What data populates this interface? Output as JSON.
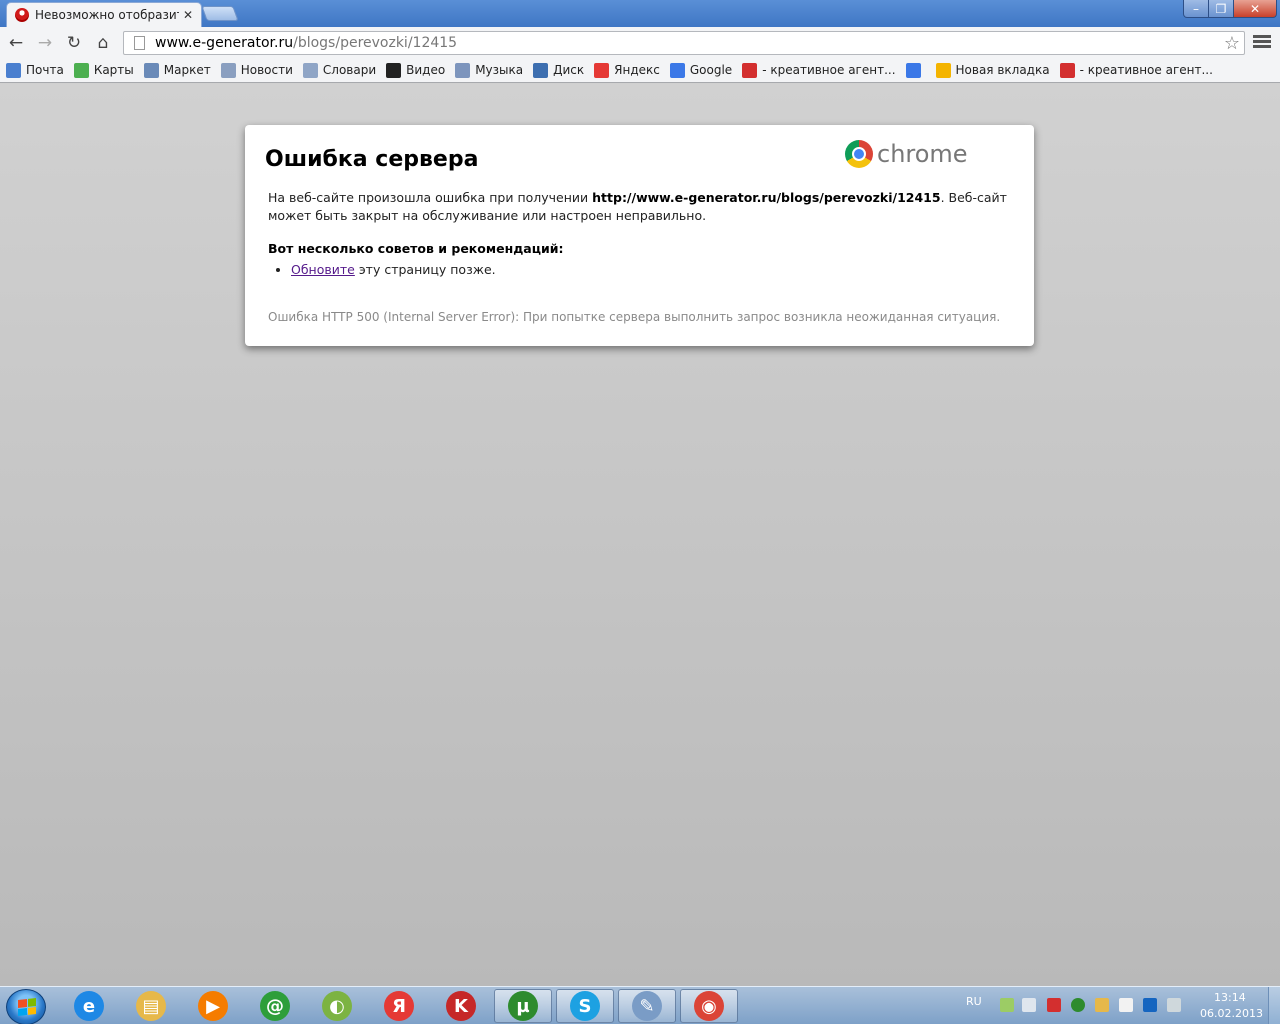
{
  "window": {
    "tab_title": "Невозможно отобразить",
    "tab_close": "✕",
    "minimize": "–",
    "maximize": "❐",
    "close": "✕"
  },
  "toolbar": {
    "back_icon": "←",
    "forward_icon": "→",
    "reload_icon": "↻",
    "home_icon": "⌂",
    "url_host": "www.e-generator.ru",
    "url_path": "/blogs/perevozki/12415",
    "star_icon": "☆"
  },
  "bookmarks": [
    {
      "label": "Почта",
      "icon": "mail-icon",
      "color": "#4a7fcf"
    },
    {
      "label": "Карты",
      "icon": "maps-icon",
      "color": "#4caf50"
    },
    {
      "label": "Маркет",
      "icon": "market-icon",
      "color": "#6a8ab8"
    },
    {
      "label": "Новости",
      "icon": "news-icon",
      "color": "#8a9fc0"
    },
    {
      "label": "Словари",
      "icon": "dictionary-icon",
      "color": "#8fa5c6"
    },
    {
      "label": "Видео",
      "icon": "video-icon",
      "color": "#222222"
    },
    {
      "label": "Музыка",
      "icon": "music-icon",
      "color": "#7d95bd"
    },
    {
      "label": "Диск",
      "icon": "disk-icon",
      "color": "#3d6fb0"
    },
    {
      "label": "Яндекс",
      "icon": "yandex-icon",
      "color": "#e53935"
    },
    {
      "label": "Google",
      "icon": "google-icon",
      "color": "#3b78e7"
    },
    {
      "label": "- креативное агент...",
      "icon": "agency-icon",
      "color": "#d32f2f"
    },
    {
      "label": "",
      "icon": "google-icon",
      "color": "#3b78e7"
    },
    {
      "label": "Новая вкладка",
      "icon": "apps-grid-icon",
      "color": "#f4b400"
    },
    {
      "label": "- креативное агент...",
      "icon": "agency-icon",
      "color": "#d32f2f"
    }
  ],
  "error": {
    "title": "Ошибка сервера",
    "logo_text": "chrome",
    "desc_before": "На веб-сайте произошла ошибка при получении ",
    "desc_url": "http://www.e-generator.ru/blogs/perevozki/12415",
    "desc_after": ". Веб-сайт может быть закрыт на обслуживание или настроен неправильно.",
    "suggest_heading": "Вот несколько советов и рекомендаций:",
    "reload_link": "Обновите",
    "reload_rest": " эту страницу позже.",
    "code_text": "Ошибка HTTP 500 (Internal Server Error): При попытке сервера выполнить запрос возникла неожиданная ситуация."
  },
  "taskbar": {
    "apps": [
      {
        "name": "internet-explorer-icon",
        "glyph": "e",
        "color": "#1e88e5",
        "active": false
      },
      {
        "name": "file-explorer-icon",
        "glyph": "▤",
        "color": "#e6b84a",
        "active": false
      },
      {
        "name": "media-player-icon",
        "glyph": "▶",
        "color": "#f57c00",
        "active": false
      },
      {
        "name": "mail-agent-icon",
        "glyph": "@",
        "color": "#2e9e3a",
        "active": false
      },
      {
        "name": "browser-orb-icon",
        "glyph": "◐",
        "color": "#7cb342",
        "active": false
      },
      {
        "name": "yandex-browser-icon",
        "glyph": "Я",
        "color": "#e53935",
        "active": false
      },
      {
        "name": "kaspersky-icon",
        "glyph": "K",
        "color": "#c62828",
        "active": false
      },
      {
        "name": "utorrent-icon",
        "glyph": "µ",
        "color": "#2e8b2e",
        "active": true
      },
      {
        "name": "skype-icon",
        "glyph": "S",
        "color": "#1da1e2",
        "active": true
      },
      {
        "name": "paint-icon",
        "glyph": "✎",
        "color": "#7a9cc6",
        "active": true
      },
      {
        "name": "chrome-icon",
        "glyph": "◉",
        "color": "#db4437",
        "active": true
      }
    ],
    "lang": "RU",
    "time": "13:14",
    "date": "06.02.2013"
  }
}
